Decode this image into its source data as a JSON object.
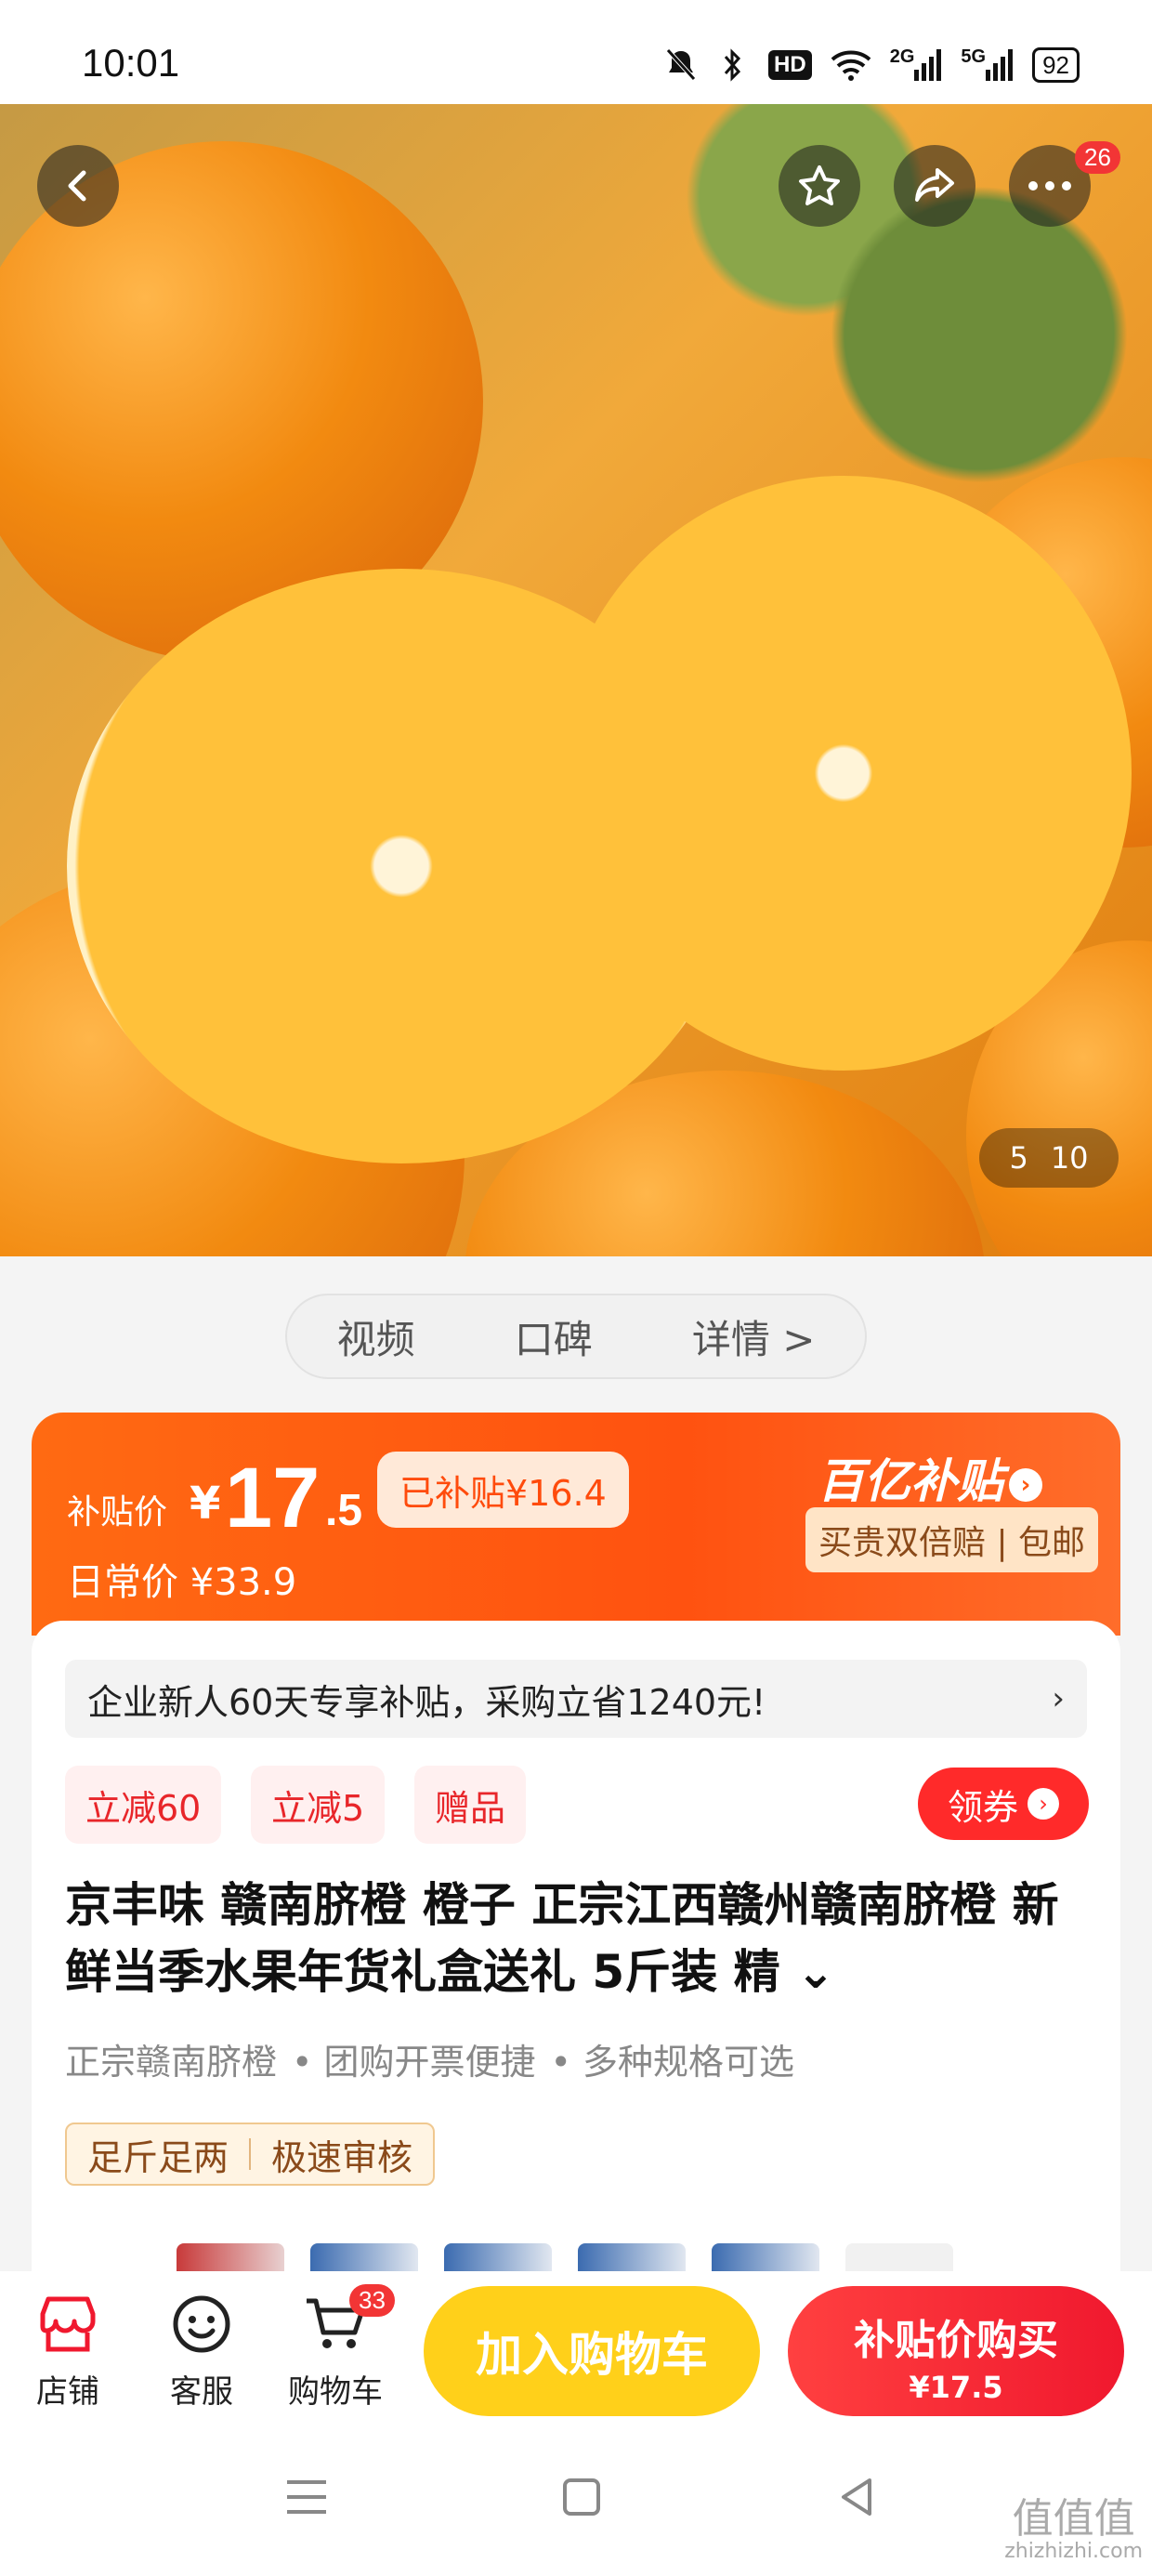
{
  "status_bar": {
    "time": "10:01",
    "icons": [
      "mute-icon",
      "bluetooth-icon",
      "hd-icon",
      "wifi-icon",
      "signal-2g-icon",
      "signal-5g-icon"
    ],
    "hd_label": "HD",
    "signal_2g": "2G",
    "signal_5g": "5G",
    "battery": "92"
  },
  "hero": {
    "more_badge": "26",
    "image_index": "5",
    "image_total": "10"
  },
  "tabs": [
    "视频",
    "口碑",
    "详情 >"
  ],
  "price": {
    "label": "补贴价",
    "currency": "¥",
    "integer": "17",
    "decimal": ".5",
    "subsidy": "已补贴¥16.4",
    "regular": "日常价 ¥33.9",
    "brand": "百亿补贴",
    "guarantee": "买贵双倍赔 | 包邮"
  },
  "promo": {
    "text": "企业新人60天专享补贴，采购立省1240元!",
    "arrow": "›"
  },
  "coupons": [
    "立减60",
    "立减5",
    "赠品"
  ],
  "claim": {
    "label": "领券",
    "arrow": "›"
  },
  "product": {
    "title": "京丰味 赣南脐橙 橙子 正宗江西赣州赣南脐橙 新鲜当季水果年货礼盒送礼 5斤装 精",
    "expand": "⌄",
    "features": [
      "正宗赣南脐橙",
      "• 团购开票便捷",
      "• 多种规格可选"
    ],
    "service_tags": [
      "足斤足两",
      "极速审核"
    ]
  },
  "action_bar": {
    "store": "店铺",
    "service": "客服",
    "cart": "购物车",
    "cart_badge": "33",
    "add_cart": "加入购物车",
    "buy_label": "补贴价购买",
    "buy_price": "¥17.5"
  },
  "watermark": {
    "logo": "值值值",
    "url": "zhizhizhi.com"
  },
  "colors": {
    "accent_orange": "#ff5a12",
    "accent_red": "#f0182e",
    "yellow": "#ffd01a"
  }
}
